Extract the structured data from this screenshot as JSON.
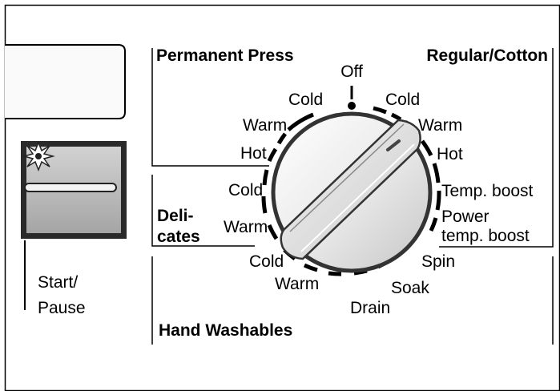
{
  "panel": {
    "sections": {
      "permanent_press": "Permanent Press",
      "regular_cotton": "Regular/Cotton",
      "delicates_line1": "Deli-",
      "delicates_line2": "cates",
      "hand_washables": "Hand Washables"
    },
    "dial": {
      "off": "Off",
      "regular": {
        "cold": "Cold",
        "warm": "Warm",
        "hot": "Hot",
        "temp_boost": "Temp. boost",
        "power_line1": "Power",
        "power_line2": "temp. boost"
      },
      "permanent_press": {
        "cold": "Cold",
        "warm": "Warm",
        "hot": "Hot"
      },
      "delicates": {
        "cold": "Cold",
        "warm": "Warm"
      },
      "hand_washables": {
        "cold": "Cold",
        "warm": "Warm"
      },
      "cycles": {
        "spin": "Spin",
        "soak": "Soak",
        "drain": "Drain"
      }
    },
    "start_pause": {
      "line1": "Start/",
      "line2": "Pause"
    }
  }
}
